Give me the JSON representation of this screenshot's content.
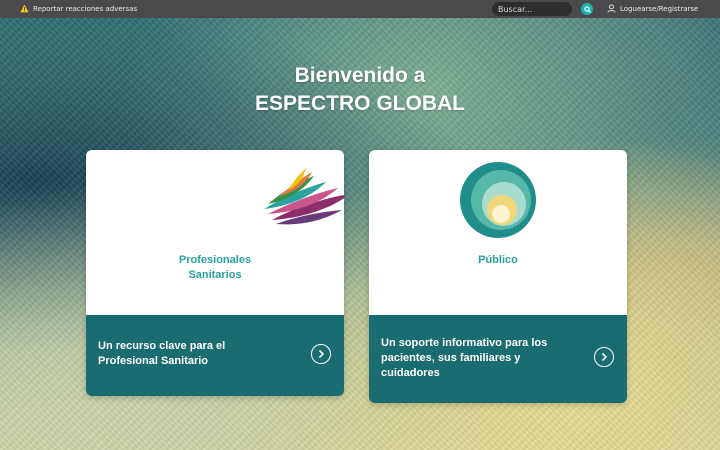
{
  "topbar": {
    "report_label": "Reportar reacciones adversas",
    "search_placeholder": "Buscar...",
    "login_label": "Loguearse/Registrarse"
  },
  "hero": {
    "title_line1": "Bienvenido a",
    "title_line2": "ESPECTRO GLOBAL"
  },
  "cards": [
    {
      "title_lines": [
        "Profesionales",
        "Sanitarios"
      ],
      "desc_lines": [
        "Un recurso clave para el",
        "Profesional Sanitario"
      ]
    },
    {
      "title_lines": [
        "Público"
      ],
      "desc_lines": [
        "Un soporte informativo para los",
        "pacientes, sus familiares y",
        "cuidadores"
      ]
    }
  ],
  "colors": {
    "accent": "#2aa3a0",
    "card_footer": "#1a6c73",
    "topbar": "#4a4a4c",
    "search_button": "#1fb3b0"
  },
  "icons": [
    "warning-icon",
    "search-icon",
    "user-icon",
    "feathers-logo",
    "spiral-logo",
    "chevron-right-icon"
  ]
}
